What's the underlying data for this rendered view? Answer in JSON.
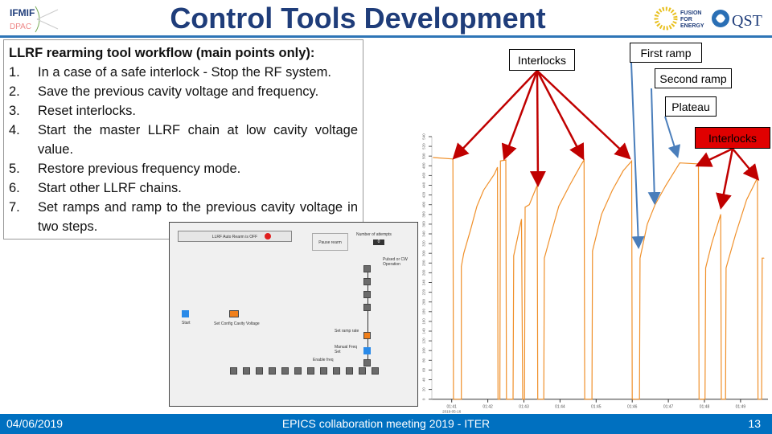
{
  "header": {
    "title": "Control Tools Development",
    "logos": {
      "left": "IFMIF",
      "right_1": "FUSION FOR ENERGY",
      "right_2": "QST"
    }
  },
  "workflow": {
    "heading": "LLRF rearming tool workflow (main points only):",
    "steps": [
      {
        "n": "1.",
        "text": "In a case of a safe interlock - Stop the RF system."
      },
      {
        "n": "2.",
        "text": "Save the previous cavity voltage and frequency."
      },
      {
        "n": "3.",
        "text": "Reset interlocks."
      },
      {
        "n": "4.",
        "text": "Start the master LLRF chain at low cavity voltage value."
      },
      {
        "n": "5.",
        "text": "Restore previous frequency mode."
      },
      {
        "n": "6.",
        "text": "Start other LLRF chains."
      },
      {
        "n": "7.",
        "text": "Set ramps and ramp to the previous cavity voltage in two steps."
      }
    ]
  },
  "gui": {
    "auto_rearm_button": "LLRF Auto Rearm is OFF",
    "pause_button": "Pause rearm",
    "attempts_label": "Number of attempts",
    "attempts_value": "0",
    "pulsed_cw": "Pulsed or CW Operation",
    "start": "Start",
    "set_config": "Set Config Cavity Voltage",
    "enable_freq": "Enable freq",
    "manual_freq": "Manual Freq Set",
    "set_ramp": "Set ramp rate",
    "colors": {
      "orange": "#f07f1a",
      "blue": "#2a8ae8",
      "gray": "#6b6b6b",
      "red": "#e02020"
    }
  },
  "callouts": {
    "interlocks_1": "Interlocks",
    "first_ramp": "First ramp",
    "second_ramp": "Second ramp",
    "plateau": "Plateau",
    "interlocks_2": "Interlocks"
  },
  "chart_data": {
    "type": "line",
    "date_label": "2019-05-16",
    "x_tick_labels": [
      "01:41",
      "01:42",
      "01:43",
      "01:44",
      "01:45",
      "01:46",
      "01:47",
      "01:48",
      "01:49"
    ],
    "ylim": [
      0,
      540
    ],
    "y_ticks": [
      0,
      20,
      40,
      60,
      80,
      100,
      120,
      140,
      160,
      180,
      200,
      220,
      240,
      260,
      280,
      300,
      320,
      340,
      360,
      380,
      400,
      420,
      440,
      460,
      480,
      500,
      520,
      540
    ],
    "series_color": "#f0902a",
    "points": [
      [
        "01:40:29",
        497
      ],
      [
        "01:41:02",
        494
      ],
      [
        "01:41:03",
        0
      ],
      [
        "01:41:16",
        0
      ],
      [
        "01:41:16",
        273
      ],
      [
        "01:41:20",
        300
      ],
      [
        "01:41:31",
        347
      ],
      [
        "01:41:42",
        397
      ],
      [
        "01:41:53",
        430
      ],
      [
        "01:42:11",
        463
      ],
      [
        "01:42:16",
        477
      ],
      [
        "01:42:17",
        0
      ],
      [
        "01:42:20",
        0
      ],
      [
        "01:42:21",
        490
      ],
      [
        "01:42:30",
        492
      ],
      [
        "01:42:31",
        0
      ],
      [
        "01:42:42",
        0
      ],
      [
        "01:42:43",
        295
      ],
      [
        "01:42:56",
        370
      ],
      [
        "01:42:58",
        0
      ],
      [
        "01:43:01",
        0
      ],
      [
        "01:43:02",
        395
      ],
      [
        "01:43:09",
        400
      ],
      [
        "01:43:22",
        440
      ],
      [
        "01:43:23",
        0
      ],
      [
        "01:43:33",
        0
      ],
      [
        "01:43:34",
        290
      ],
      [
        "01:43:45",
        340
      ],
      [
        "01:43:58",
        397
      ],
      [
        "01:44:16",
        440
      ],
      [
        "01:44:34",
        480
      ],
      [
        "01:44:40",
        492
      ],
      [
        "01:44:41",
        0
      ],
      [
        "01:44:53",
        0
      ],
      [
        "01:44:54",
        305
      ],
      [
        "01:45:09",
        380
      ],
      [
        "01:45:27",
        430
      ],
      [
        "01:45:45",
        470
      ],
      [
        "01:45:59",
        490
      ],
      [
        "01:46:00",
        0
      ],
      [
        "01:46:12",
        0
      ],
      [
        "01:46:13",
        290
      ],
      [
        "01:46:25",
        360
      ],
      [
        "01:46:38",
        400
      ],
      [
        "01:46:56",
        440
      ],
      [
        "01:47:19",
        486
      ],
      [
        "01:47:50",
        484
      ],
      [
        "01:47:51",
        0
      ],
      [
        "01:48:01",
        0
      ],
      [
        "01:48:02",
        270
      ],
      [
        "01:48:12",
        320
      ],
      [
        "01:48:27",
        380
      ],
      [
        "01:48:28",
        0
      ],
      [
        "01:48:35",
        0
      ],
      [
        "01:48:36",
        270
      ],
      [
        "01:48:52",
        340
      ],
      [
        "01:49:10",
        410
      ],
      [
        "01:49:28",
        455
      ],
      [
        "01:49:29",
        0
      ],
      [
        "01:49:35",
        0
      ],
      [
        "01:49:36",
        290
      ],
      [
        "01:49:39",
        290
      ]
    ]
  },
  "footer": {
    "date": "04/06/2019",
    "event": "EPICS collaboration meeting 2019 - ITER",
    "page": "13"
  }
}
